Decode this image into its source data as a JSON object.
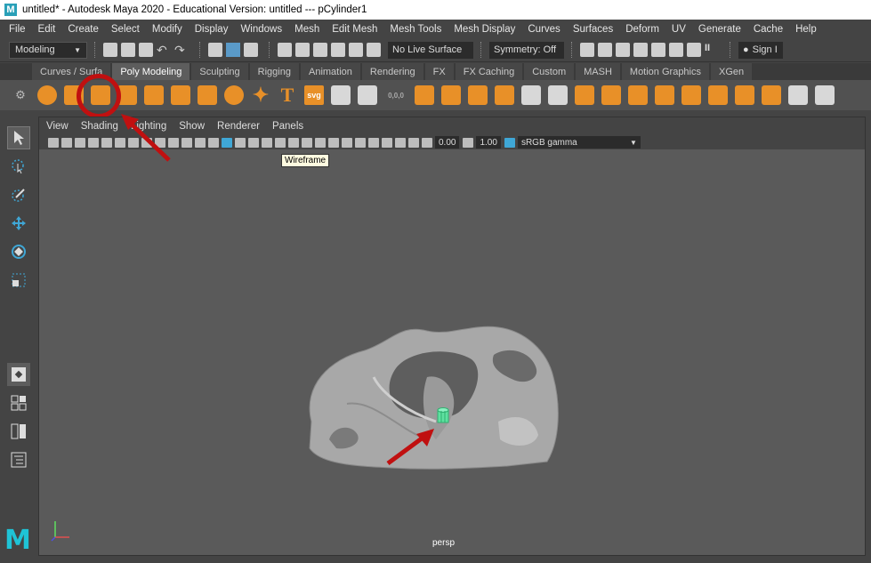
{
  "window": {
    "title": "untitled* - Autodesk Maya 2020 - Educational Version: untitled    ---    pCylinder1"
  },
  "menubar": {
    "items": [
      "File",
      "Edit",
      "Create",
      "Select",
      "Modify",
      "Display",
      "Windows",
      "Mesh",
      "Edit Mesh",
      "Mesh Tools",
      "Mesh Display",
      "Curves",
      "Surfaces",
      "Deform",
      "UV",
      "Generate",
      "Cache",
      "Help"
    ]
  },
  "statusline": {
    "mode": "Modeling",
    "live_surface": "No Live Surface",
    "symmetry": "Symmetry: Off",
    "sign_in": "Sign I"
  },
  "shelf": {
    "tabs": [
      "Curves / Surfa",
      "Poly Modeling",
      "Sculpting",
      "Rigging",
      "Animation",
      "Rendering",
      "FX",
      "FX Caching",
      "Custom",
      "MASH",
      "Motion Graphics",
      "XGen"
    ],
    "active_tab": "Poly Modeling",
    "text_tool": "T",
    "svg_tool": "svg",
    "counter": "0,0,0"
  },
  "viewport": {
    "menu": [
      "View",
      "Shading",
      "Lighting",
      "Show",
      "Renderer",
      "Panels"
    ],
    "exposure": "0.00",
    "gamma_value": "1.00",
    "color_space": "sRGB gamma",
    "tooltip": "Wireframe",
    "camera": "persp"
  },
  "colors": {
    "accent": "#e89028",
    "annotation": "#c01010",
    "selection": "#3fa7d6",
    "cylinder": "#5fe0a0"
  }
}
